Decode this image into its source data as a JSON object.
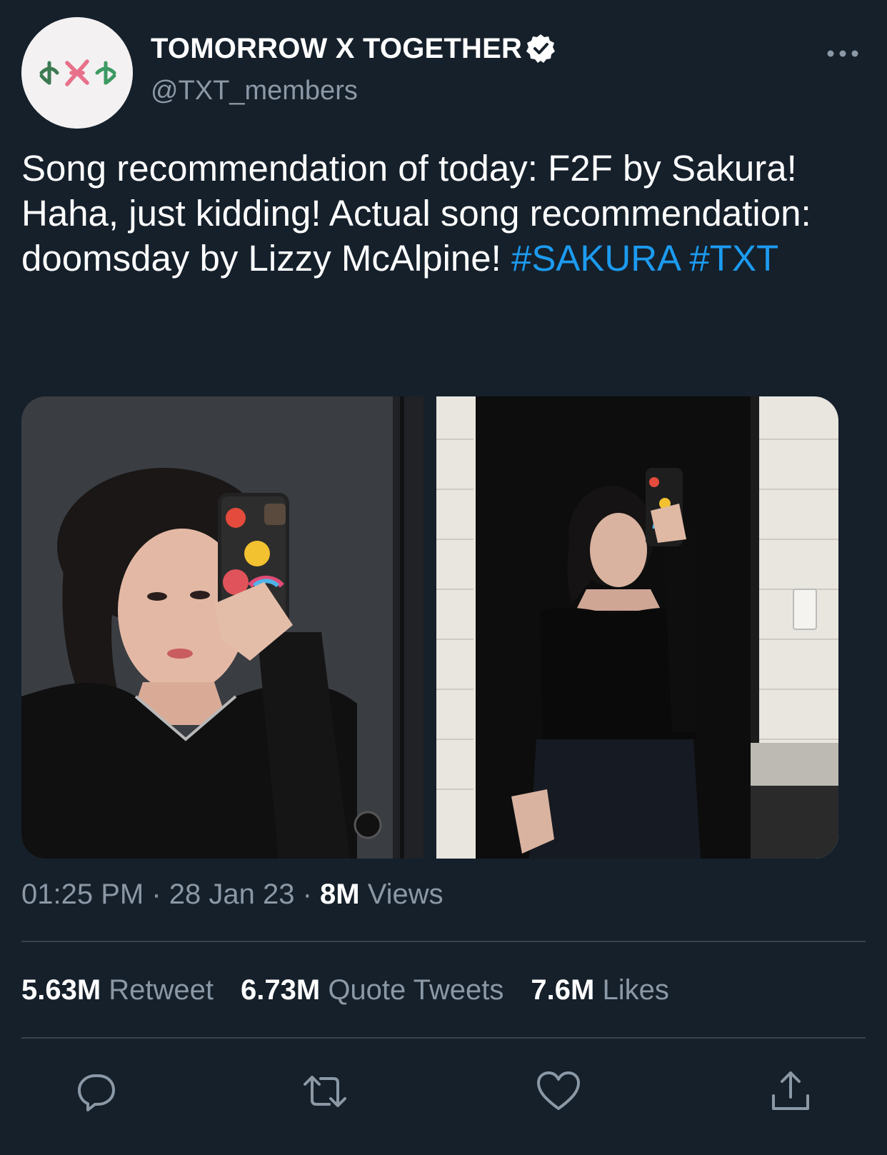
{
  "author": {
    "display_name": "TOMORROW X TOGETHER",
    "handle": "@TXT_members",
    "verified": true,
    "avatar_icon": "txt-logo-icon"
  },
  "tweet": {
    "text_plain": "Song recommendation of today: F2F by Sakura! Haha, just kidding! Actual song recommendation: doomsday by Lizzy McAlpine! ",
    "hashtags": [
      "#SAKURA",
      "#TXT"
    ]
  },
  "media": {
    "photos": [
      {
        "name": "photo-1"
      },
      {
        "name": "photo-2"
      }
    ]
  },
  "meta": {
    "time": "01:25 PM",
    "separator": " · ",
    "date": "28 Jan 23",
    "views_count": "8M",
    "views_label": " Views"
  },
  "stats": [
    {
      "count": "5.63M",
      "label": " Retweet"
    },
    {
      "count": "6.73M",
      "label": " Quote Tweets"
    },
    {
      "count": "7.6M",
      "label": " Likes"
    }
  ],
  "actions": [
    {
      "icon": "reply-icon"
    },
    {
      "icon": "retweet-icon"
    },
    {
      "icon": "like-icon"
    },
    {
      "icon": "share-icon"
    }
  ],
  "colors": {
    "background": "#15202b",
    "text_primary": "#ffffff",
    "text_secondary": "#8b98a5",
    "hashtag": "#1d9bf0",
    "divider": "#38444d"
  }
}
